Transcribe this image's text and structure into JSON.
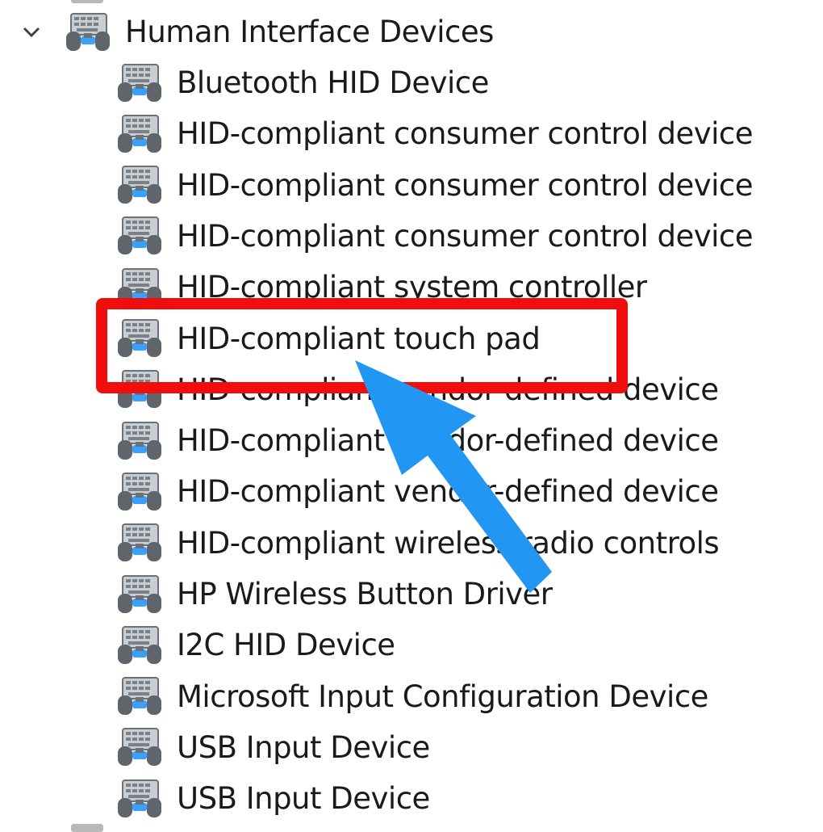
{
  "category": {
    "label": "Human Interface Devices",
    "expander_icon": "chevron-down-icon",
    "icon": "hid-device-icon"
  },
  "devices": [
    {
      "label": "Bluetooth HID Device"
    },
    {
      "label": "HID-compliant consumer control device"
    },
    {
      "label": "HID-compliant consumer control device"
    },
    {
      "label": "HID-compliant consumer control device"
    },
    {
      "label": "HID-compliant system controller"
    },
    {
      "label": "HID-compliant touch pad"
    },
    {
      "label": "HID-compliant vendor-defined device"
    },
    {
      "label": "HID-compliant vendor-defined device"
    },
    {
      "label": "HID-compliant vendor-defined device"
    },
    {
      "label": "HID-compliant wireless radio controls"
    },
    {
      "label": "HP Wireless Button Driver"
    },
    {
      "label": "I2C HID Device"
    },
    {
      "label": "Microsoft Input Configuration Device"
    },
    {
      "label": "USB Input Device"
    },
    {
      "label": "USB Input Device"
    }
  ],
  "annotation": {
    "highlight_color": "#f20d0d",
    "arrow_color": "#2196f3",
    "highlighted_item": "HID-compliant touch pad"
  },
  "colors": {
    "text": "#1a1a1a",
    "background": "#ffffff",
    "icon_body": "#9aa0a6",
    "icon_accent": "#3aa0ff"
  }
}
